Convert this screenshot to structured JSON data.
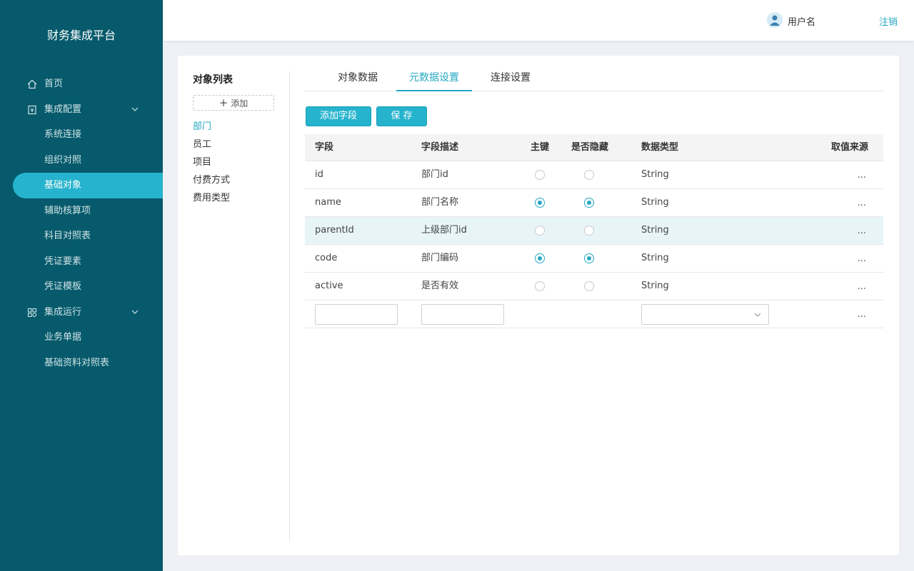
{
  "brand": "财务集成平台",
  "header": {
    "username": "用户名",
    "logout": "注销"
  },
  "menu": [
    {
      "label": "首页",
      "icon": "home-icon"
    },
    {
      "label": "集成配置",
      "icon": "config-icon",
      "expandable": true
    },
    {
      "label": "系统连接"
    },
    {
      "label": "组织对照"
    },
    {
      "label": "基础对象",
      "active": true
    },
    {
      "label": "辅助核算项"
    },
    {
      "label": "科目对照表"
    },
    {
      "label": "凭证要素"
    },
    {
      "label": "凭证模板"
    },
    {
      "label": "集成运行",
      "icon": "grid-icon",
      "expandable": true
    },
    {
      "label": "业务单据"
    },
    {
      "label": "基础资料对照表"
    }
  ],
  "objects": {
    "title": "对象列表",
    "add_label": "添加",
    "items": [
      "部门",
      "员工",
      "项目",
      "付费方式",
      "费用类型"
    ]
  },
  "tabs": [
    "对象数据",
    "元数据设置",
    "连接设置"
  ],
  "buttons": {
    "add_field": "添加字段",
    "save": "保 存"
  },
  "table": {
    "headers": [
      "字段",
      "字段描述",
      "主键",
      "是否隐藏",
      "数据类型",
      "取值来源"
    ],
    "rows": [
      {
        "field": "id",
        "desc": "部门id",
        "pk": false,
        "hidden": false,
        "type": "String",
        "more": "..."
      },
      {
        "field": "name",
        "desc": "部门名称",
        "pk": true,
        "hidden": true,
        "type": "String",
        "more": "..."
      },
      {
        "field": "parentId",
        "desc": "上级部门id",
        "pk": false,
        "hidden": false,
        "type": "String",
        "more": "..."
      },
      {
        "field": "code",
        "desc": "部门编码",
        "pk": true,
        "hidden": true,
        "type": "String",
        "more": "..."
      },
      {
        "field": "active",
        "desc": "是否有效",
        "pk": false,
        "hidden": false,
        "type": "String",
        "more": "..."
      }
    ],
    "new_row_more": "..."
  },
  "colors": {
    "sidebar": "#065a6b",
    "accent": "#26b3cd"
  }
}
